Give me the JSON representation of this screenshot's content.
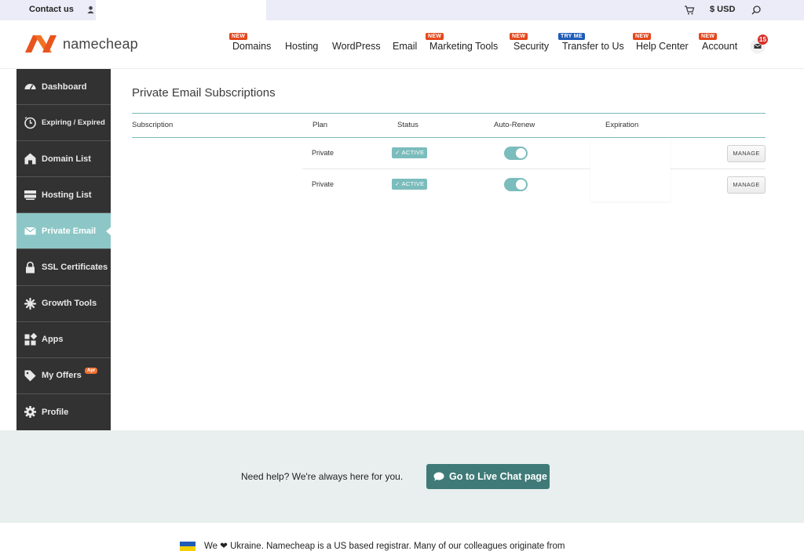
{
  "topbar": {
    "contact": "Contact us",
    "currency": "$ USD",
    "icons": [
      "user-icon",
      "cart-icon",
      "search-icon"
    ]
  },
  "header": {
    "logo_text": "namecheap",
    "nav": [
      {
        "label": "Domains",
        "badge": "NEW"
      },
      {
        "label": "Hosting",
        "badge": ""
      },
      {
        "label": "WordPress",
        "badge": ""
      },
      {
        "label": "Email",
        "badge": ""
      },
      {
        "label": "Marketing Tools",
        "badge": "NEW"
      },
      {
        "label": "Security",
        "badge": "NEW"
      },
      {
        "label": "Transfer to Us",
        "badge": "TRY ME"
      },
      {
        "label": "Help Center",
        "badge": "NEW"
      },
      {
        "label": "Account",
        "badge": "NEW"
      }
    ],
    "mail_count": "15"
  },
  "sidebar": {
    "items": [
      {
        "label": "Dashboard",
        "icon": "gauge-icon"
      },
      {
        "label": "Expiring / Expired",
        "icon": "clock-icon"
      },
      {
        "label": "Domain List",
        "icon": "house-icon"
      },
      {
        "label": "Hosting List",
        "icon": "server-icon"
      },
      {
        "label": "Private Email",
        "icon": "envelope-icon",
        "active": true
      },
      {
        "label": "SSL Certificates",
        "icon": "lock-icon"
      },
      {
        "label": "Growth Tools",
        "icon": "sparkle-icon"
      },
      {
        "label": "Apps",
        "icon": "apps-icon"
      },
      {
        "label": "My Offers",
        "icon": "tag-icon",
        "badge": "Apr"
      },
      {
        "label": "Profile",
        "icon": "gear-icon"
      }
    ]
  },
  "main": {
    "title": "Private Email Subscriptions",
    "columns": [
      "Subscription",
      "Plan",
      "Status",
      "Auto-Renew",
      "Expiration"
    ],
    "rows": [
      {
        "plan": "Private",
        "status": "ACTIVE",
        "auto_renew": true,
        "action": "MANAGE"
      },
      {
        "plan": "Private",
        "status": "ACTIVE",
        "auto_renew": true,
        "action": "MANAGE"
      }
    ]
  },
  "help": {
    "text": "Need help? We're always here for you.",
    "button": "Go to Live Chat page"
  },
  "footer": {
    "text": "We ❤ Ukraine. Namecheap is a US based registrar. Many of our colleagues originate from"
  },
  "colors": {
    "teal": "#7bbcbc",
    "sidebar_bg": "#323232",
    "brand_orange": "#e4471c",
    "chat_button": "#3f7a78"
  }
}
